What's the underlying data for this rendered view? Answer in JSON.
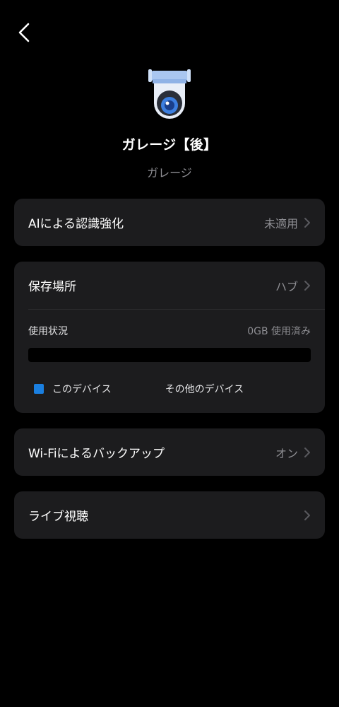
{
  "device": {
    "name": "ガレージ【後】",
    "room": "ガレージ",
    "icon": "security-camera-icon"
  },
  "ai_row": {
    "label": "AIによる認識強化",
    "value": "未適用"
  },
  "storage": {
    "label": "保存場所",
    "value": "ハブ",
    "usage_label": "使用状況",
    "usage_value": "0GB 使用済み",
    "usage_fraction": 0,
    "legend": [
      {
        "label": "このデバイス",
        "color": "#1a7fe0"
      },
      {
        "label": "その他のデバイス",
        "color": "#1c1c1e"
      }
    ]
  },
  "wifi_row": {
    "label": "Wi-Fiによるバックアップ",
    "value": "オン"
  },
  "live_row": {
    "label": "ライブ視聴"
  },
  "colors": {
    "background": "#000000",
    "card": "#1c1c1e",
    "secondary_text": "#8e8e93",
    "accent": "#1a7fe0"
  }
}
